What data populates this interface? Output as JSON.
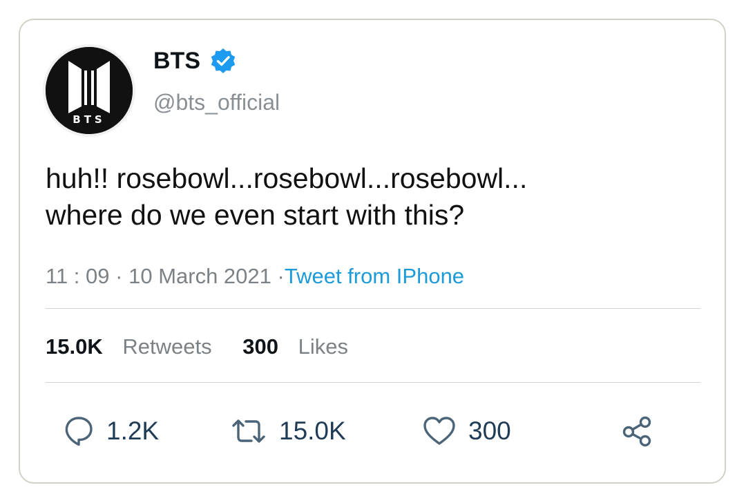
{
  "user": {
    "display_name": "BTS",
    "handle": "@bts_official",
    "avatar_logo_text": "BTS",
    "verified": true
  },
  "tweet": {
    "lines": [
      "huh!! rosebowl...rosebowl...rosebowl...",
      "where do we even start with this?"
    ],
    "time": "11 : 09",
    "date": "10 March 2021",
    "separator": "·",
    "source": "Tweet from IPhone"
  },
  "stats": {
    "retweets_count": "15.0K",
    "retweets_label": "Retweets",
    "likes_count": "300",
    "likes_label": "Likes"
  },
  "actions": {
    "reply_count": "1.2K",
    "retweet_count": "15.0K",
    "like_count": "300",
    "reply_icon": "reply-icon",
    "retweet_icon": "retweet-icon",
    "like_icon": "heart-icon",
    "share_icon": "share-icon"
  },
  "colors": {
    "link": "#1d9bd8",
    "muted": "#7c8186",
    "verified": "#1d9bf0",
    "action": "#1f3b55"
  }
}
